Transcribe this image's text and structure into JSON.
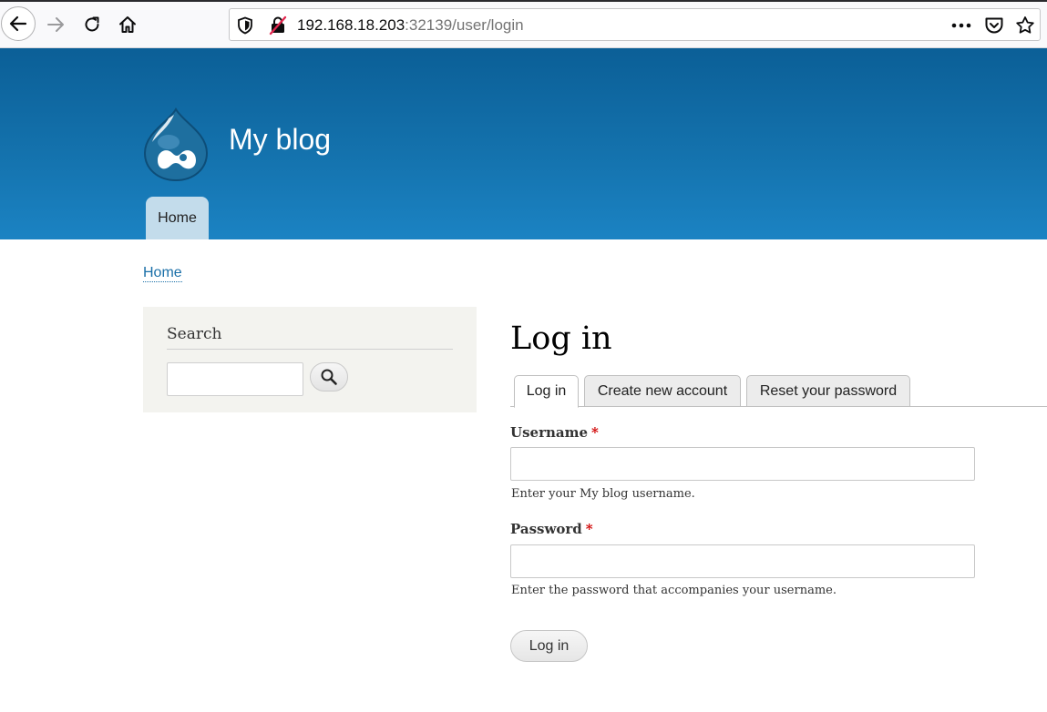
{
  "browser": {
    "url_host": "192.168.18.203",
    "url_port_path": ":32139/user/login"
  },
  "site": {
    "name": "My blog",
    "nav": {
      "home": "Home"
    }
  },
  "breadcrumb": {
    "home": "Home"
  },
  "search": {
    "title": "Search"
  },
  "login": {
    "title": "Log in",
    "tabs": [
      {
        "label": "Log in",
        "active": true
      },
      {
        "label": "Create new account",
        "active": false
      },
      {
        "label": "Reset your password",
        "active": false
      }
    ],
    "username": {
      "label": "Username",
      "required_mark": "*",
      "value": "",
      "description": "Enter your My blog username."
    },
    "password": {
      "label": "Password",
      "required_mark": "*",
      "value": "",
      "description": "Enter the password that accompanies your username."
    },
    "submit_label": "Log in"
  },
  "colors": {
    "header_top": "#0b5f97",
    "header_bottom": "#1b83c3",
    "nav_tab_bg": "#c3dceb",
    "link": "#1a6fa8",
    "required": "#d00000"
  }
}
